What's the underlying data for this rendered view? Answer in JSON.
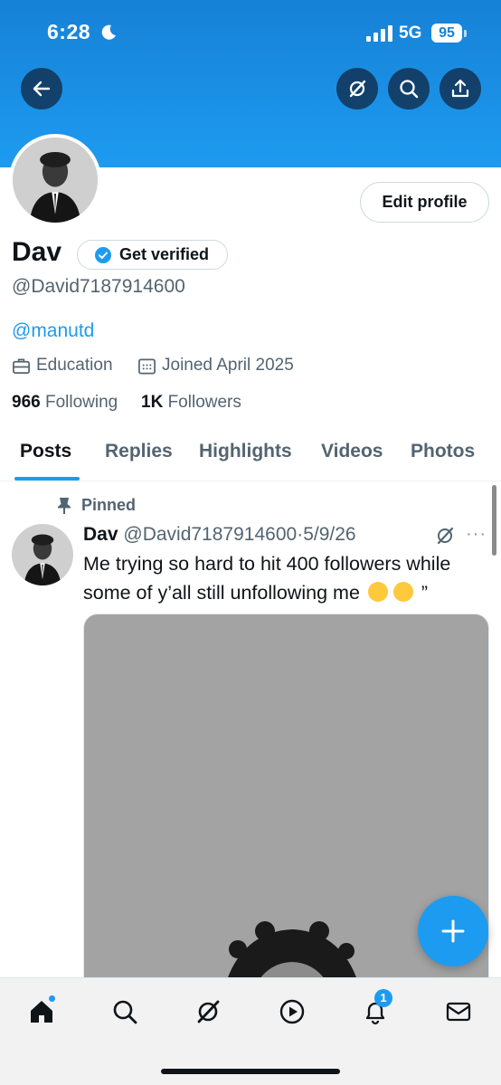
{
  "status_bar": {
    "time": "6:28",
    "network": "5G",
    "battery": "95"
  },
  "header": {
    "back_icon": "arrow-left-icon",
    "grok_icon": "grok-icon",
    "search_icon": "search-icon",
    "share_icon": "share-icon"
  },
  "profile": {
    "name": "Dav",
    "verify_label": "Get verified",
    "handle": "@David7187914600",
    "bio_link": "@manutd",
    "category": "Education",
    "joined": "Joined April 2025",
    "following_count": "966",
    "following_label": "Following",
    "followers_count": "1K",
    "followers_label": "Followers",
    "edit_label": "Edit profile"
  },
  "tabs": [
    "Posts",
    "Replies",
    "Highlights",
    "Videos",
    "Photos"
  ],
  "active_tab": "Posts",
  "post": {
    "pinned_label": "Pinned",
    "author": "Dav",
    "handle": "@David7187914600",
    "separator": "·",
    "date": "5/9/26",
    "more": "···",
    "text_main": "Me trying so hard to hit 400 followers while some of y’all still unfollowing me",
    "text_tail": "”",
    "emojis": [
      "loudly-crying-face",
      "pensive-face"
    ]
  },
  "bottom_nav": {
    "items": [
      "home-icon",
      "search-icon",
      "grok-icon",
      "video-play-icon",
      "notifications-bell-icon",
      "messages-envelope-icon"
    ],
    "notification_count": "1"
  },
  "colors": {
    "accent": "#1d9bf0",
    "text": "#0f1419",
    "secondary": "#536471",
    "banner": "#1d9bf0"
  }
}
